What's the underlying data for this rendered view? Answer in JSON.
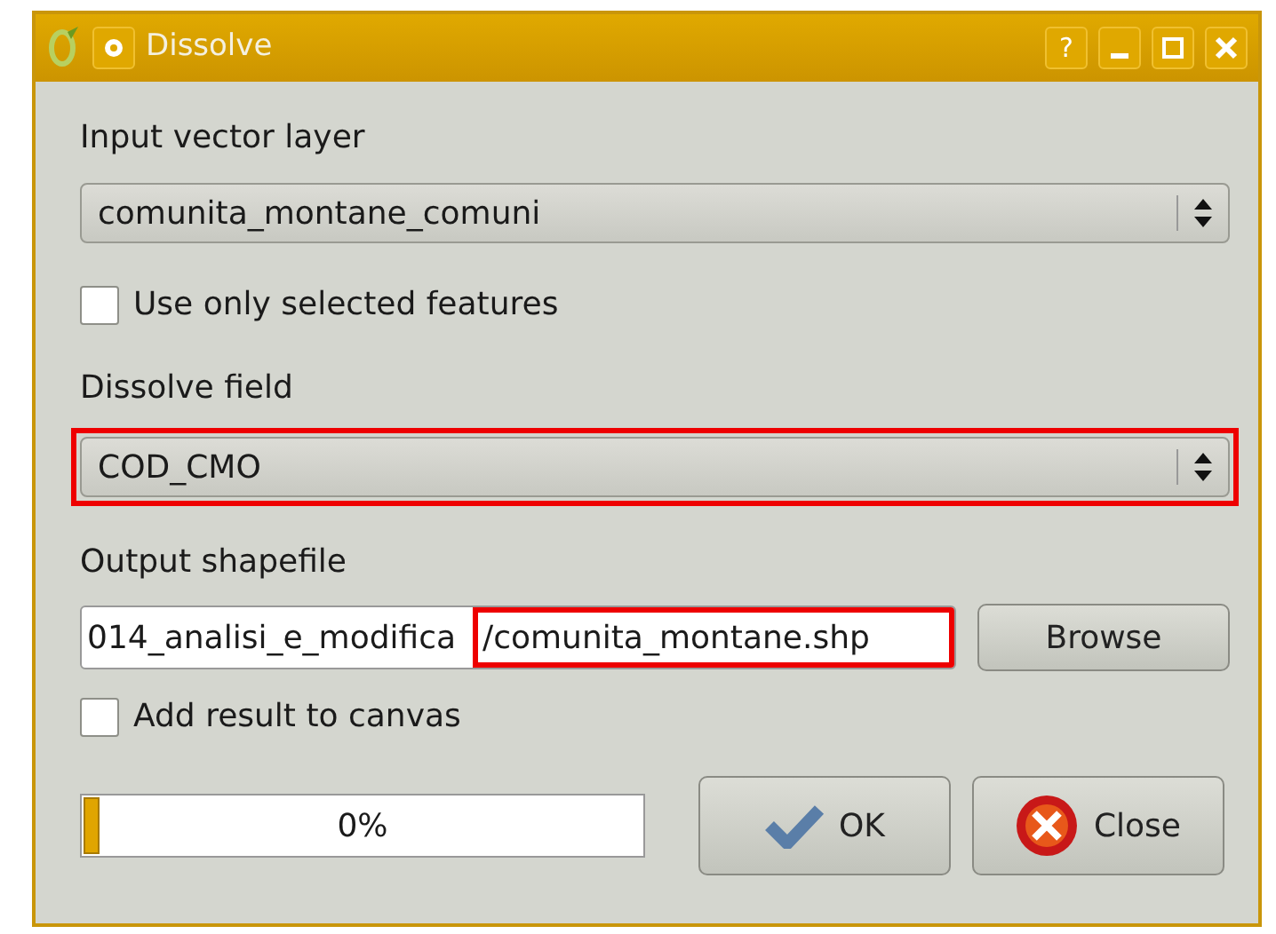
{
  "window": {
    "title": "Dissolve",
    "buttons": [
      "?"
    ]
  },
  "input_layer": {
    "label": "Input vector layer",
    "value": "comunita_montane_comuni",
    "highlighted": false
  },
  "selected_only": {
    "label": "Use only selected features",
    "checked": false
  },
  "dissolve_field": {
    "label": "Dissolve field",
    "value": "COD_CMO",
    "highlighted": true
  },
  "output": {
    "label": "Output shapefile",
    "segments": [
      {
        "text": "014_analisi_e_modifica",
        "highlighted": false
      },
      {
        "text": "/comunita_montane.shp",
        "highlighted": true
      }
    ],
    "browse": "Browse"
  },
  "add_to_canvas": {
    "label": "Add result to canvas",
    "checked": false
  },
  "progress": {
    "level": 0,
    "reading": "0%"
  },
  "ok": "OK",
  "close": "Close"
}
